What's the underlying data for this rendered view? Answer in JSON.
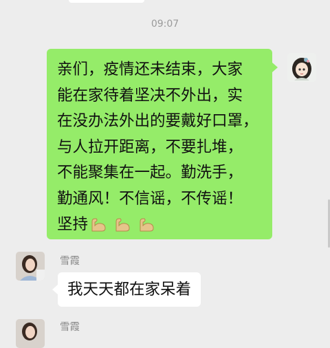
{
  "chat": {
    "timestamp": "09:07",
    "messages": [
      {
        "sender": "self",
        "lines": [
          "亲们，疫情还未结束，大家",
          "能在家待着坚决不外出，实",
          "在没办法外出的要戴好口罩，",
          "与人拉开距离，不要扎堆，",
          "不能聚集在一起。勤洗手，",
          "勤通风！不信谣，不传谣！",
          "坚持"
        ],
        "emojis": [
          "flexed-biceps-icon",
          "flexed-biceps-icon",
          "flexed-biceps-icon"
        ]
      },
      {
        "sender": "雪霞",
        "text": "我天天都在家呆着"
      },
      {
        "sender": "雪霞",
        "text": ""
      }
    ]
  },
  "colors": {
    "background": "#ededed",
    "self_bubble": "#95ec69",
    "other_bubble": "#ffffff",
    "timestamp": "#9a9a9a",
    "sender_name": "#8a8a8a"
  }
}
